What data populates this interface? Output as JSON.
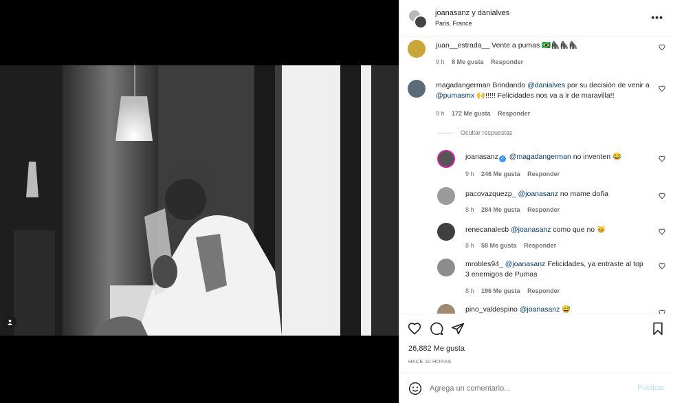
{
  "header": {
    "names": "joanasanz y danialves",
    "location": "Paris, France",
    "more_icon": "more-horizontal-icon"
  },
  "comments": [
    {
      "user": "juan__estrada__",
      "text": "Vente a pumas 🇧🇷🦍🦍🦍",
      "time": "9 h",
      "likes": "8 Me gusta",
      "reply": "Responder"
    },
    {
      "user": "magadangerman",
      "text_before": "Brindando ",
      "mention1": "@danialves",
      "text_mid": " por su decisión de venir a ",
      "mention2": "@pumasmx",
      "text_after": " 🙌!!!!! Felicidades nos va a ir de maravilla!!",
      "time": "9 h",
      "likes": "172 Me gusta",
      "reply": "Responder"
    }
  ],
  "hide_replies": "Ocultar respuestas",
  "replies": [
    {
      "user": "joanasanz",
      "mention": "@magadangerman",
      "text": " no inventen 😂",
      "time": "9 h",
      "likes": "246 Me gusta",
      "reply": "Responder"
    },
    {
      "user": "pacovazquezp_",
      "mention": "@joanasanz",
      "text": " no mame doña",
      "time": "8 h",
      "likes": "284 Me gusta",
      "reply": "Responder"
    },
    {
      "user": "renecanalesb",
      "mention": "@joanasanz",
      "text": " como que no 😸",
      "time": "8 h",
      "likes": "58 Me gusta",
      "reply": "Responder"
    },
    {
      "user": "mrobles94_",
      "mention": "@joanasanz",
      "text": " Felicidades, ya entraste al top 3 enemigos de Pumas",
      "time": "8 h",
      "likes": "196 Me gusta",
      "reply": "Responder"
    },
    {
      "user": "pino_valdespino",
      "mention": "@joanasanz",
      "text": " 😅"
    }
  ],
  "post": {
    "likes": "26,882 Me gusta",
    "time_ago": "HACE 10 HORAS"
  },
  "add_comment": {
    "placeholder": "Agrega un comentario...",
    "publish": "Publicar"
  },
  "colors": {
    "mention": "#00376b",
    "muted": "#737373",
    "publish_disabled": "#b2dffc",
    "verified": "#3897f0"
  }
}
